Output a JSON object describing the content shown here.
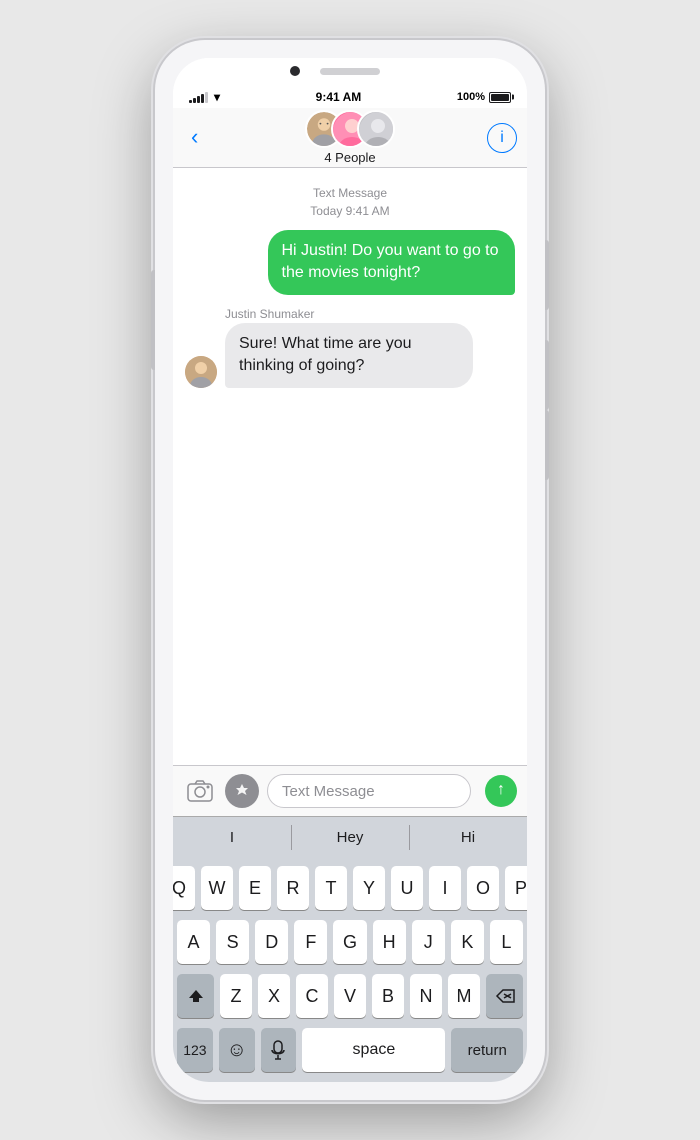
{
  "phone": {
    "status_bar": {
      "time": "9:41 AM",
      "battery_percent": "100%",
      "signal_bars": 4,
      "wifi": true
    },
    "nav": {
      "back_label": "",
      "people_count": "4 People",
      "info_icon": "ⓘ"
    },
    "messages": {
      "type_label": "Text Message",
      "time_label": "Today 9:41 AM",
      "sent_message": "Hi Justin! Do you want to go to the movies tonight?",
      "received_sender": "Justin Shumaker",
      "received_message": "Sure! What time are you thinking of going?"
    },
    "input": {
      "placeholder": "Text Message"
    },
    "predictive": {
      "items": [
        "I",
        "Hey",
        "Hi"
      ]
    },
    "keyboard": {
      "row1": [
        "Q",
        "W",
        "E",
        "R",
        "T",
        "Y",
        "U",
        "I",
        "O",
        "P"
      ],
      "row2": [
        "A",
        "S",
        "D",
        "F",
        "G",
        "H",
        "J",
        "K",
        "L"
      ],
      "row3": [
        "Z",
        "X",
        "C",
        "V",
        "B",
        "N",
        "M"
      ],
      "bottom": {
        "numbers": "123",
        "emoji": "😊",
        "mic": "🎤",
        "space": "space",
        "return": "return"
      }
    }
  }
}
